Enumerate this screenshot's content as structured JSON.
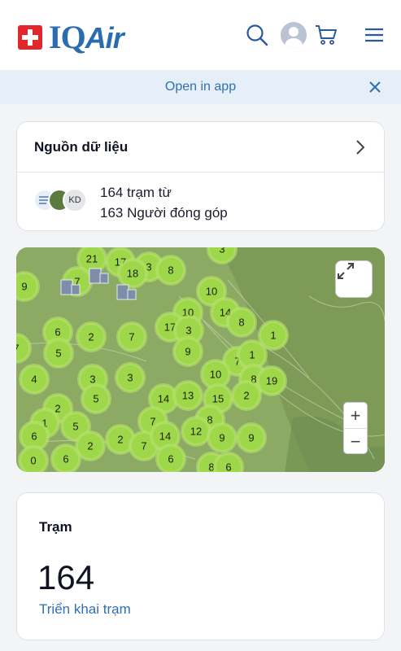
{
  "header": {
    "brand": "IQAir",
    "icons": [
      "search-icon",
      "avatar",
      "cart-icon",
      "menu-icon"
    ]
  },
  "banner": {
    "text": "Open in app"
  },
  "data_source": {
    "title": "Nguồn dữ liệu",
    "badge_initials": "KD",
    "line1": "164 trạm từ",
    "line2": "163 Người đóng góp"
  },
  "map": {
    "clusters": [
      {
        "label": "3"
      },
      {
        "label": "21"
      },
      {
        "label": "17"
      },
      {
        "label": "3"
      },
      {
        "label": "8"
      },
      {
        "label": "18"
      },
      {
        "label": "9"
      },
      {
        "label": "7"
      },
      {
        "label": "10"
      },
      {
        "label": "14"
      },
      {
        "label": "10"
      },
      {
        "label": "8"
      },
      {
        "label": "1"
      },
      {
        "label": "6"
      },
      {
        "label": "2"
      },
      {
        "label": "7"
      },
      {
        "label": "17"
      },
      {
        "label": "3"
      },
      {
        "label": "7"
      },
      {
        "label": "5"
      },
      {
        "label": "9"
      },
      {
        "label": "3"
      },
      {
        "label": "7"
      },
      {
        "label": "1"
      },
      {
        "label": "4"
      },
      {
        "label": "3"
      },
      {
        "label": "10"
      },
      {
        "label": "8"
      },
      {
        "label": "19"
      },
      {
        "label": "2"
      },
      {
        "label": "2"
      },
      {
        "label": "5"
      },
      {
        "label": "14"
      },
      {
        "label": "13"
      },
      {
        "label": "15"
      },
      {
        "label": "1"
      },
      {
        "label": "5"
      },
      {
        "label": "7"
      },
      {
        "label": "8"
      },
      {
        "label": "6"
      },
      {
        "label": "2"
      },
      {
        "label": "2"
      },
      {
        "label": "7"
      },
      {
        "label": "14"
      },
      {
        "label": "12"
      },
      {
        "label": "9"
      },
      {
        "label": "9"
      },
      {
        "label": "0"
      },
      {
        "label": "6"
      },
      {
        "label": "6"
      },
      {
        "label": "8"
      },
      {
        "label": "6"
      }
    ],
    "zoom_in": "+",
    "zoom_out": "−"
  },
  "stations": {
    "title": "Trạm",
    "count": "164",
    "link": "Triển khai trạm"
  },
  "colors": {
    "brand_blue": "#2b6cb0",
    "link_blue": "#2f6fb5",
    "cluster_green": "#9ed84a",
    "map_bg": "#7e9a57"
  }
}
